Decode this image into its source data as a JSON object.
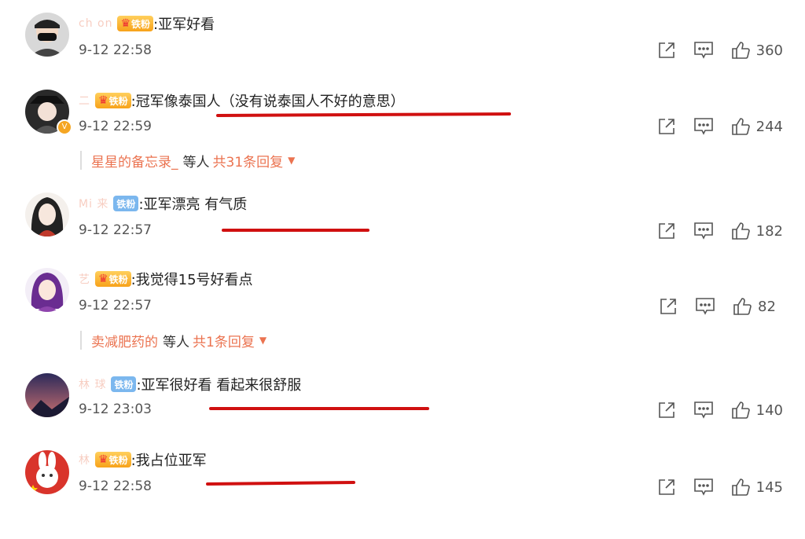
{
  "comments": [
    {
      "username": "ch       on",
      "badge": "铁粉",
      "badge_style": "gold",
      "text": ":亚军好看",
      "time": "9-12 22:58",
      "likes": "360",
      "avatar_icon": "masked-person-icon",
      "verified": false
    },
    {
      "username": "二           ",
      "badge": "铁粉",
      "badge_style": "gold",
      "text": ":冠军像泰国人（没有说泰国人不好的意思）",
      "time": "9-12 22:59",
      "likes": "244",
      "avatar_icon": "person-with-hat-icon",
      "verified": true,
      "replies": {
        "user": "星星的备忘录_",
        "middle": "等人",
        "count_text": "共31条回复"
      }
    },
    {
      "username": "Mi            来",
      "badge": "铁粉",
      "badge_style": "blue",
      "text": ":亚军漂亮 有气质",
      "time": "9-12 22:57",
      "likes": "182",
      "avatar_icon": "anime-girl-icon",
      "verified": false
    },
    {
      "username": "艺         ",
      "badge": "铁粉",
      "badge_style": "gold",
      "text": ":我觉得15号好看点",
      "time": "9-12 22:57",
      "likes": "82",
      "avatar_icon": "purple-hair-girl-icon",
      "verified": false,
      "replies": {
        "user": "卖减肥药的",
        "middle": "等人",
        "count_text": "共1条回复"
      }
    },
    {
      "username": "林           球",
      "badge": "铁粉",
      "badge_style": "blue",
      "text": ":亚军很好看 看起来很舒服",
      "time": "9-12 23:03",
      "likes": "140",
      "avatar_icon": "night-sky-icon",
      "verified": false
    },
    {
      "username": "林         ",
      "badge": "铁粉",
      "badge_style": "gold",
      "text": ":我占位亚军",
      "time": "9-12 22:58",
      "likes": "145",
      "avatar_icon": "rabbit-icon",
      "verified": false
    }
  ],
  "colors": {
    "accent": "#eb7350",
    "underline": "#d01010",
    "badge_gold": "#f7a21a",
    "badge_blue": "#7bb7ee"
  },
  "icons": {
    "share": "share-icon",
    "comment": "comment-icon",
    "like": "thumbs-up-icon",
    "expand": "caret-down-icon",
    "crown": "crown-icon"
  }
}
